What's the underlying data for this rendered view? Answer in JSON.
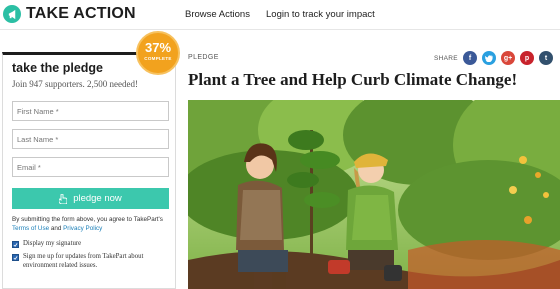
{
  "brand": {
    "name": "TAKE ACTION",
    "accent": "#2bbfa4"
  },
  "nav": {
    "browse": "Browse Actions",
    "login": "Login to track your impact"
  },
  "pledge": {
    "title": "take the pledge",
    "subtitle": "Join 947 supporters. 2,500 needed!",
    "progress": {
      "percent": "37%",
      "fraction": 0.37,
      "label": "COMPLETE",
      "color": "#f2a21e"
    },
    "fields": {
      "first_name": {
        "label": "First Name *",
        "value": ""
      },
      "last_name": {
        "label": "Last Name *",
        "value": ""
      },
      "email": {
        "label": "Email *",
        "value": ""
      }
    },
    "button": {
      "label": "pledge now",
      "icon": "hand-icon",
      "color": "#3cc8ad"
    },
    "terms": {
      "before": "By submitting the form above, you agree to TakePart's",
      "terms_link": "Terms of Use",
      "and": "and",
      "privacy_link": "Privacy Policy"
    },
    "checkboxes": [
      {
        "label": "Display my signature",
        "checked": true
      },
      {
        "label": "Sign me up for updates from TakePart about environment related issues.",
        "checked": true
      }
    ]
  },
  "article": {
    "kicker": "PLEDGE",
    "headline": "Plant a Tree and Help Curb Climate Change!",
    "share": {
      "label": "SHARE",
      "networks": [
        "facebook-icon",
        "twitter-icon",
        "google-plus-icon",
        "pinterest-icon",
        "tumblr-icon"
      ],
      "glyphs": {
        "facebook": "f",
        "google": "g+",
        "pinterest": "p",
        "tumblr": "t"
      }
    }
  }
}
